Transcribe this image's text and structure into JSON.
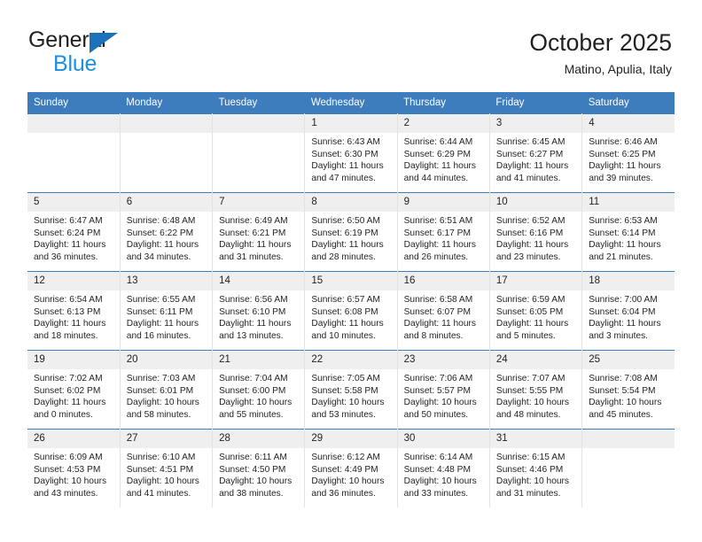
{
  "brand": {
    "name_part1": "General",
    "name_part2": "Blue",
    "accent_color": "#1c8fe0",
    "triangle_color": "#1c71b9"
  },
  "header": {
    "title": "October 2025",
    "subtitle": "Matino, Apulia, Italy"
  },
  "theme": {
    "header_row_bg": "#3d7cbd",
    "daynum_bg": "#efefef",
    "text_color": "#231f20",
    "cell_border": "#e3e3e3"
  },
  "weekdays": [
    "Sunday",
    "Monday",
    "Tuesday",
    "Wednesday",
    "Thursday",
    "Friday",
    "Saturday"
  ],
  "weeks": [
    [
      {
        "day": "",
        "sunrise": "",
        "sunset": "",
        "daylight_line1": "",
        "daylight_line2": ""
      },
      {
        "day": "",
        "sunrise": "",
        "sunset": "",
        "daylight_line1": "",
        "daylight_line2": ""
      },
      {
        "day": "",
        "sunrise": "",
        "sunset": "",
        "daylight_line1": "",
        "daylight_line2": ""
      },
      {
        "day": "1",
        "sunrise": "Sunrise: 6:43 AM",
        "sunset": "Sunset: 6:30 PM",
        "daylight_line1": "Daylight: 11 hours",
        "daylight_line2": "and 47 minutes."
      },
      {
        "day": "2",
        "sunrise": "Sunrise: 6:44 AM",
        "sunset": "Sunset: 6:29 PM",
        "daylight_line1": "Daylight: 11 hours",
        "daylight_line2": "and 44 minutes."
      },
      {
        "day": "3",
        "sunrise": "Sunrise: 6:45 AM",
        "sunset": "Sunset: 6:27 PM",
        "daylight_line1": "Daylight: 11 hours",
        "daylight_line2": "and 41 minutes."
      },
      {
        "day": "4",
        "sunrise": "Sunrise: 6:46 AM",
        "sunset": "Sunset: 6:25 PM",
        "daylight_line1": "Daylight: 11 hours",
        "daylight_line2": "and 39 minutes."
      }
    ],
    [
      {
        "day": "5",
        "sunrise": "Sunrise: 6:47 AM",
        "sunset": "Sunset: 6:24 PM",
        "daylight_line1": "Daylight: 11 hours",
        "daylight_line2": "and 36 minutes."
      },
      {
        "day": "6",
        "sunrise": "Sunrise: 6:48 AM",
        "sunset": "Sunset: 6:22 PM",
        "daylight_line1": "Daylight: 11 hours",
        "daylight_line2": "and 34 minutes."
      },
      {
        "day": "7",
        "sunrise": "Sunrise: 6:49 AM",
        "sunset": "Sunset: 6:21 PM",
        "daylight_line1": "Daylight: 11 hours",
        "daylight_line2": "and 31 minutes."
      },
      {
        "day": "8",
        "sunrise": "Sunrise: 6:50 AM",
        "sunset": "Sunset: 6:19 PM",
        "daylight_line1": "Daylight: 11 hours",
        "daylight_line2": "and 28 minutes."
      },
      {
        "day": "9",
        "sunrise": "Sunrise: 6:51 AM",
        "sunset": "Sunset: 6:17 PM",
        "daylight_line1": "Daylight: 11 hours",
        "daylight_line2": "and 26 minutes."
      },
      {
        "day": "10",
        "sunrise": "Sunrise: 6:52 AM",
        "sunset": "Sunset: 6:16 PM",
        "daylight_line1": "Daylight: 11 hours",
        "daylight_line2": "and 23 minutes."
      },
      {
        "day": "11",
        "sunrise": "Sunrise: 6:53 AM",
        "sunset": "Sunset: 6:14 PM",
        "daylight_line1": "Daylight: 11 hours",
        "daylight_line2": "and 21 minutes."
      }
    ],
    [
      {
        "day": "12",
        "sunrise": "Sunrise: 6:54 AM",
        "sunset": "Sunset: 6:13 PM",
        "daylight_line1": "Daylight: 11 hours",
        "daylight_line2": "and 18 minutes."
      },
      {
        "day": "13",
        "sunrise": "Sunrise: 6:55 AM",
        "sunset": "Sunset: 6:11 PM",
        "daylight_line1": "Daylight: 11 hours",
        "daylight_line2": "and 16 minutes."
      },
      {
        "day": "14",
        "sunrise": "Sunrise: 6:56 AM",
        "sunset": "Sunset: 6:10 PM",
        "daylight_line1": "Daylight: 11 hours",
        "daylight_line2": "and 13 minutes."
      },
      {
        "day": "15",
        "sunrise": "Sunrise: 6:57 AM",
        "sunset": "Sunset: 6:08 PM",
        "daylight_line1": "Daylight: 11 hours",
        "daylight_line2": "and 10 minutes."
      },
      {
        "day": "16",
        "sunrise": "Sunrise: 6:58 AM",
        "sunset": "Sunset: 6:07 PM",
        "daylight_line1": "Daylight: 11 hours",
        "daylight_line2": "and 8 minutes."
      },
      {
        "day": "17",
        "sunrise": "Sunrise: 6:59 AM",
        "sunset": "Sunset: 6:05 PM",
        "daylight_line1": "Daylight: 11 hours",
        "daylight_line2": "and 5 minutes."
      },
      {
        "day": "18",
        "sunrise": "Sunrise: 7:00 AM",
        "sunset": "Sunset: 6:04 PM",
        "daylight_line1": "Daylight: 11 hours",
        "daylight_line2": "and 3 minutes."
      }
    ],
    [
      {
        "day": "19",
        "sunrise": "Sunrise: 7:02 AM",
        "sunset": "Sunset: 6:02 PM",
        "daylight_line1": "Daylight: 11 hours",
        "daylight_line2": "and 0 minutes."
      },
      {
        "day": "20",
        "sunrise": "Sunrise: 7:03 AM",
        "sunset": "Sunset: 6:01 PM",
        "daylight_line1": "Daylight: 10 hours",
        "daylight_line2": "and 58 minutes."
      },
      {
        "day": "21",
        "sunrise": "Sunrise: 7:04 AM",
        "sunset": "Sunset: 6:00 PM",
        "daylight_line1": "Daylight: 10 hours",
        "daylight_line2": "and 55 minutes."
      },
      {
        "day": "22",
        "sunrise": "Sunrise: 7:05 AM",
        "sunset": "Sunset: 5:58 PM",
        "daylight_line1": "Daylight: 10 hours",
        "daylight_line2": "and 53 minutes."
      },
      {
        "day": "23",
        "sunrise": "Sunrise: 7:06 AM",
        "sunset": "Sunset: 5:57 PM",
        "daylight_line1": "Daylight: 10 hours",
        "daylight_line2": "and 50 minutes."
      },
      {
        "day": "24",
        "sunrise": "Sunrise: 7:07 AM",
        "sunset": "Sunset: 5:55 PM",
        "daylight_line1": "Daylight: 10 hours",
        "daylight_line2": "and 48 minutes."
      },
      {
        "day": "25",
        "sunrise": "Sunrise: 7:08 AM",
        "sunset": "Sunset: 5:54 PM",
        "daylight_line1": "Daylight: 10 hours",
        "daylight_line2": "and 45 minutes."
      }
    ],
    [
      {
        "day": "26",
        "sunrise": "Sunrise: 6:09 AM",
        "sunset": "Sunset: 4:53 PM",
        "daylight_line1": "Daylight: 10 hours",
        "daylight_line2": "and 43 minutes."
      },
      {
        "day": "27",
        "sunrise": "Sunrise: 6:10 AM",
        "sunset": "Sunset: 4:51 PM",
        "daylight_line1": "Daylight: 10 hours",
        "daylight_line2": "and 41 minutes."
      },
      {
        "day": "28",
        "sunrise": "Sunrise: 6:11 AM",
        "sunset": "Sunset: 4:50 PM",
        "daylight_line1": "Daylight: 10 hours",
        "daylight_line2": "and 38 minutes."
      },
      {
        "day": "29",
        "sunrise": "Sunrise: 6:12 AM",
        "sunset": "Sunset: 4:49 PM",
        "daylight_line1": "Daylight: 10 hours",
        "daylight_line2": "and 36 minutes."
      },
      {
        "day": "30",
        "sunrise": "Sunrise: 6:14 AM",
        "sunset": "Sunset: 4:48 PM",
        "daylight_line1": "Daylight: 10 hours",
        "daylight_line2": "and 33 minutes."
      },
      {
        "day": "31",
        "sunrise": "Sunrise: 6:15 AM",
        "sunset": "Sunset: 4:46 PM",
        "daylight_line1": "Daylight: 10 hours",
        "daylight_line2": "and 31 minutes."
      },
      {
        "day": "",
        "sunrise": "",
        "sunset": "",
        "daylight_line1": "",
        "daylight_line2": ""
      }
    ]
  ]
}
